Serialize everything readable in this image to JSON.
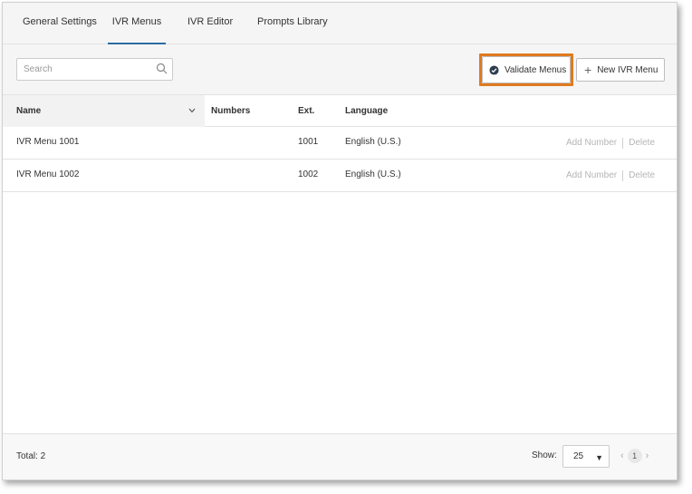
{
  "tabs": [
    {
      "label": "General Settings",
      "active": false
    },
    {
      "label": "IVR Menus",
      "active": true
    },
    {
      "label": "IVR Editor",
      "active": false
    },
    {
      "label": "Prompts Library",
      "active": false
    }
  ],
  "toolbar": {
    "search_placeholder": "Search",
    "search_value": "",
    "validate_label": "Validate Menus",
    "new_label": "New IVR Menu",
    "highlight_color": "#e07a1f"
  },
  "table": {
    "headers": {
      "name": "Name",
      "numbers": "Numbers",
      "ext": "Ext.",
      "language": "Language"
    },
    "rows": [
      {
        "name": "IVR Menu 1001",
        "numbers": "",
        "ext": "1001",
        "language": "English (U.S.)",
        "add_number": "Add Number",
        "delete": "Delete"
      },
      {
        "name": "IVR Menu 1002",
        "numbers": "",
        "ext": "1002",
        "language": "English (U.S.)",
        "add_number": "Add Number",
        "delete": "Delete"
      }
    ]
  },
  "footer": {
    "total": "Total: 2",
    "show_label": "Show:",
    "page_size": "25",
    "current_page": "1"
  },
  "colors": {
    "accent": "#2b6ca3",
    "highlight": "#e07a1f"
  }
}
